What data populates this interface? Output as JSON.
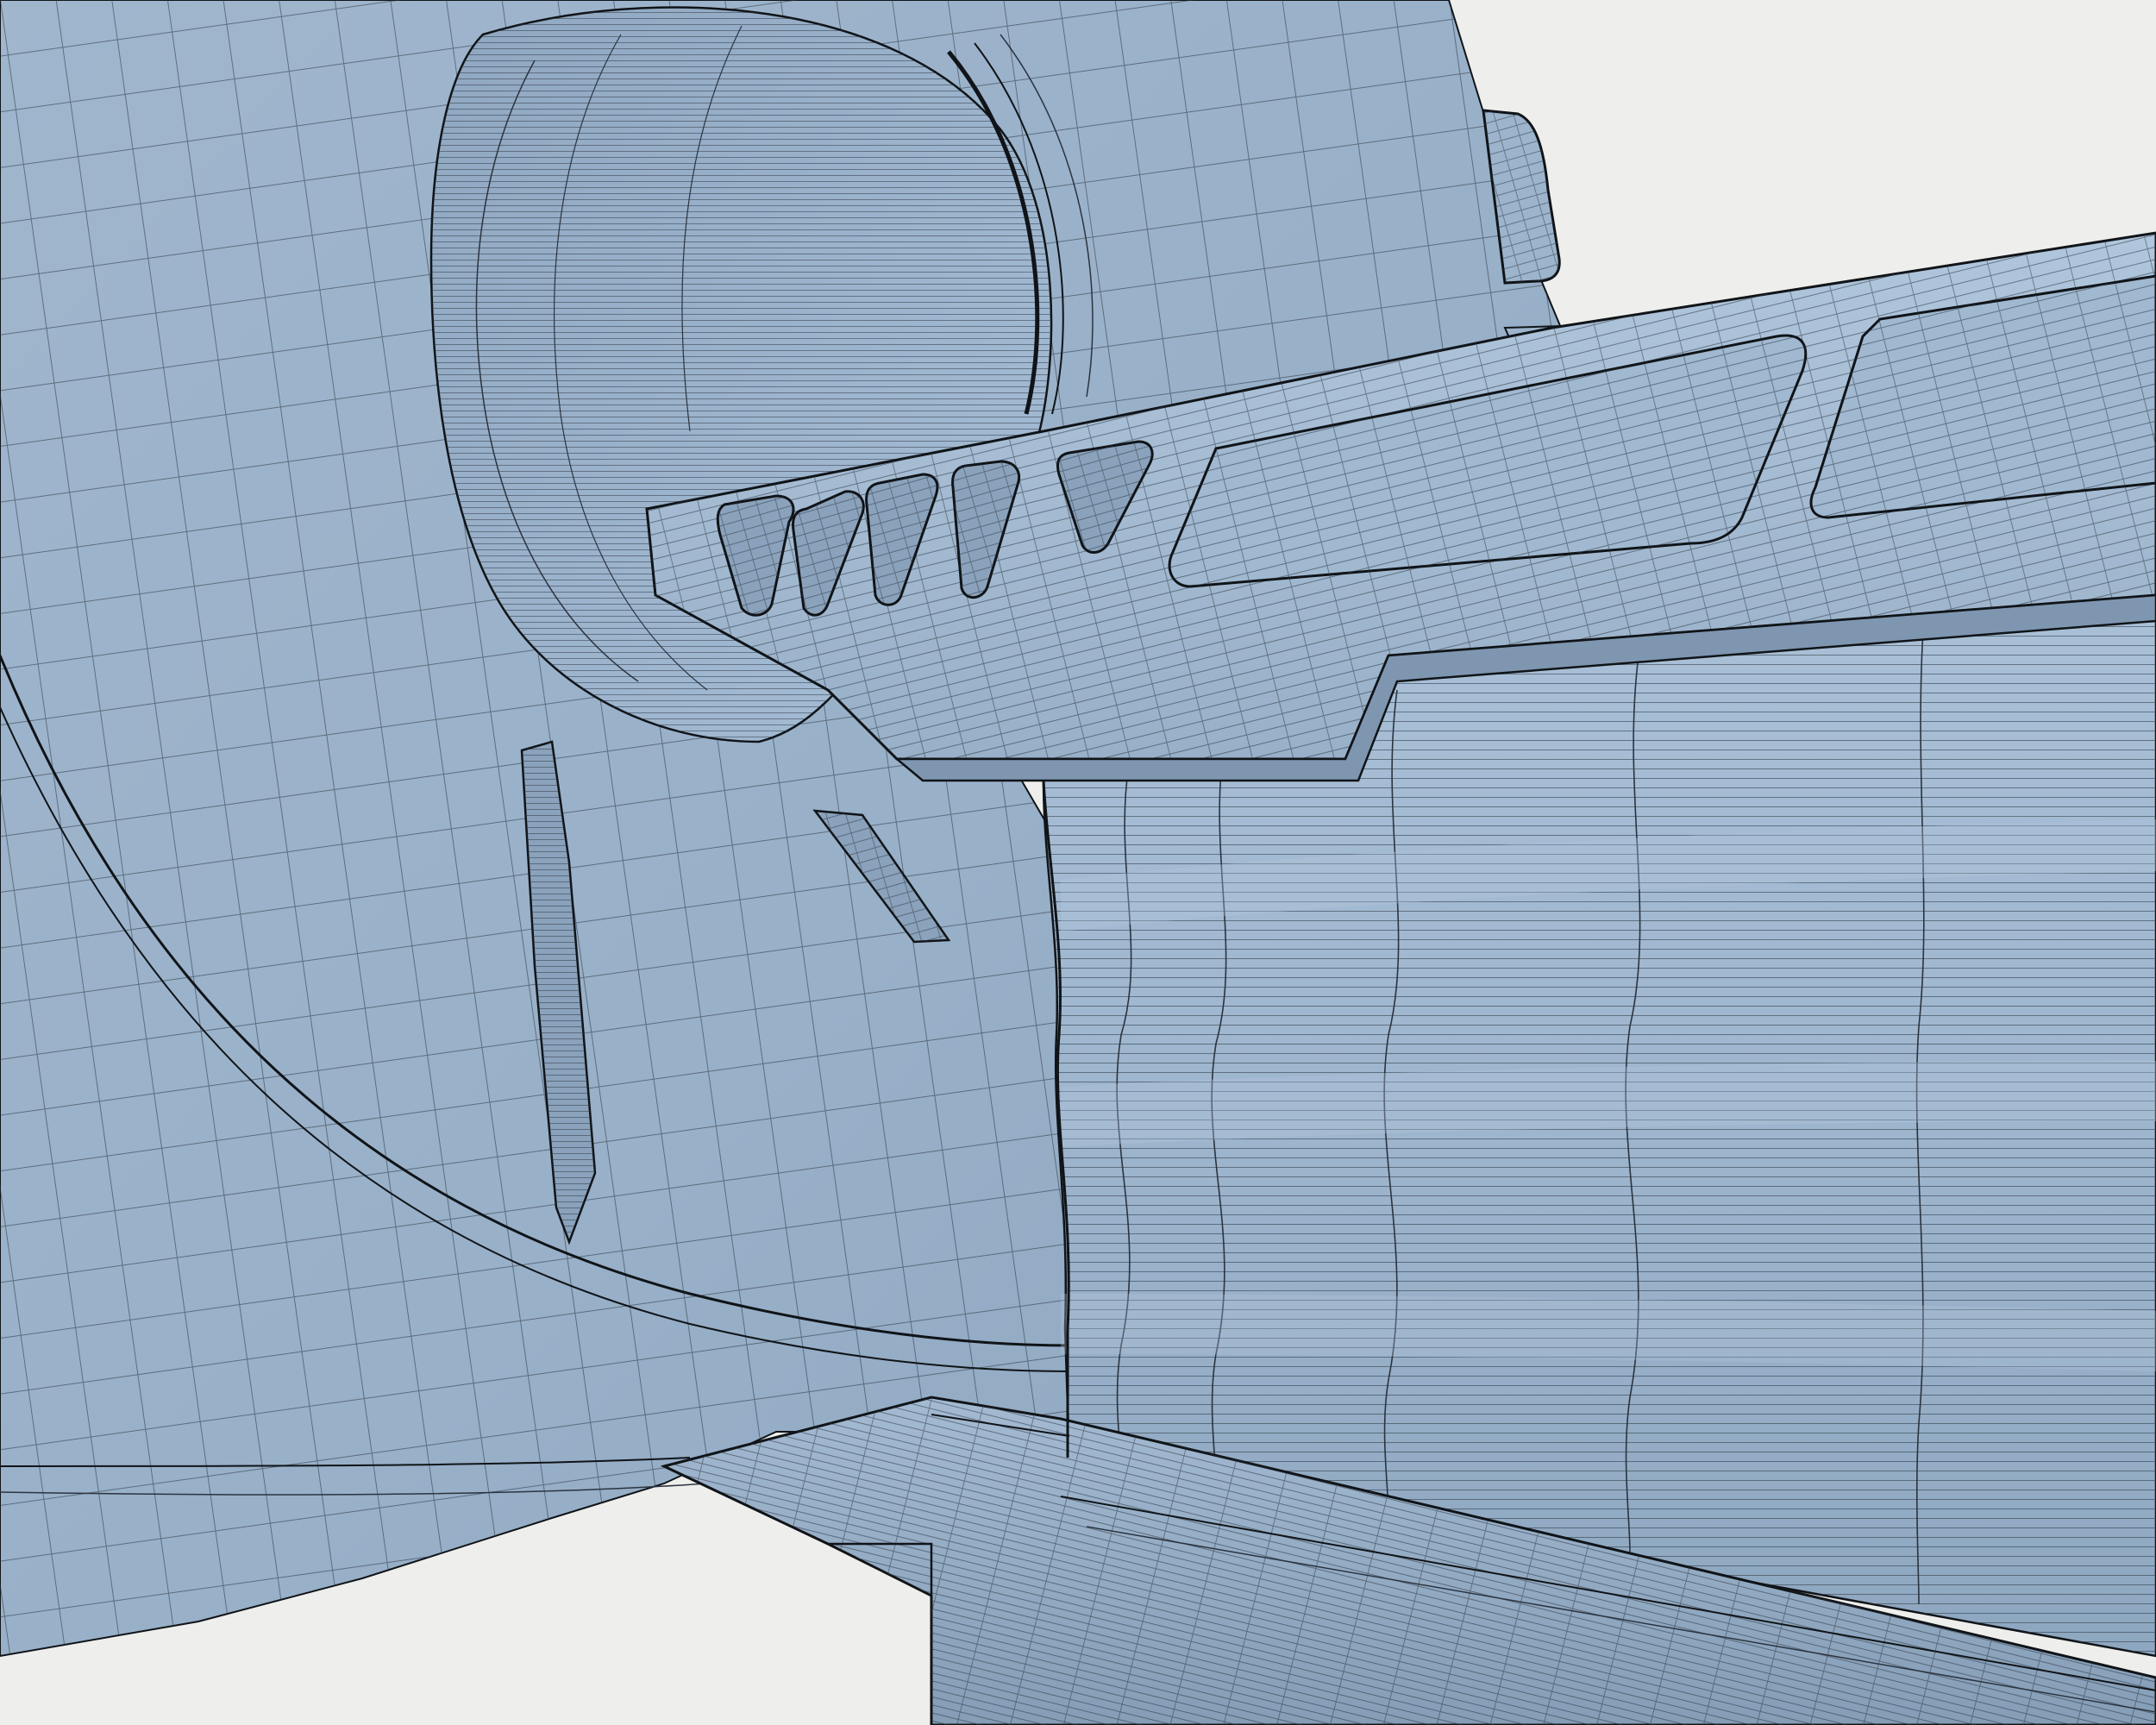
{
  "scene": {
    "subject": "wireframe-render",
    "colors": {
      "background": "#eeeeec",
      "surface_light": "#a8bfd6",
      "surface_mid": "#94acc4",
      "surface_dark": "#7f97b0",
      "wire": "#2b3440",
      "edge": "#101418"
    }
  }
}
